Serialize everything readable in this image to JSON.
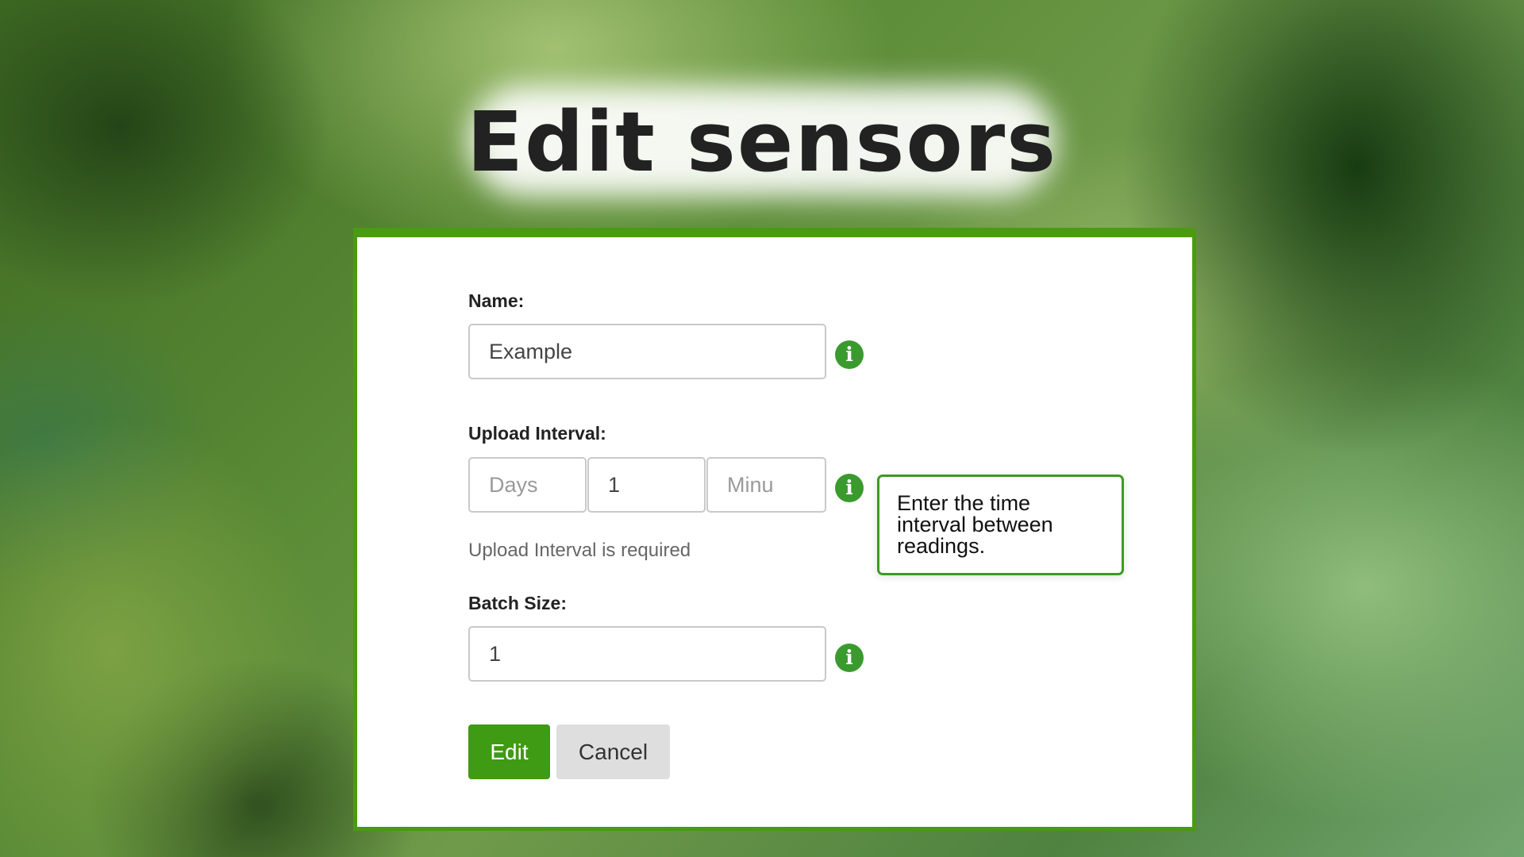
{
  "page": {
    "title": "Edit sensors"
  },
  "form": {
    "name": {
      "label": "Name:",
      "value": "Example"
    },
    "upload_interval": {
      "label": "Upload Interval:",
      "days_placeholder": "Days",
      "hours_value": "1",
      "minutes_placeholder": "Minu",
      "error": "Upload Interval is required"
    },
    "batch_size": {
      "label": "Batch Size:",
      "value": "1"
    },
    "tooltip": "Enter the time interval between readings.",
    "info_icon_glyph": "i",
    "edit_label": "Edit",
    "cancel_label": "Cancel"
  },
  "colors": {
    "accent": "#4a9a12",
    "icon": "#3a9a2e",
    "button_primary": "#3f9a14",
    "button_secondary": "#dedede"
  },
  "icons": [
    "info-icon"
  ]
}
